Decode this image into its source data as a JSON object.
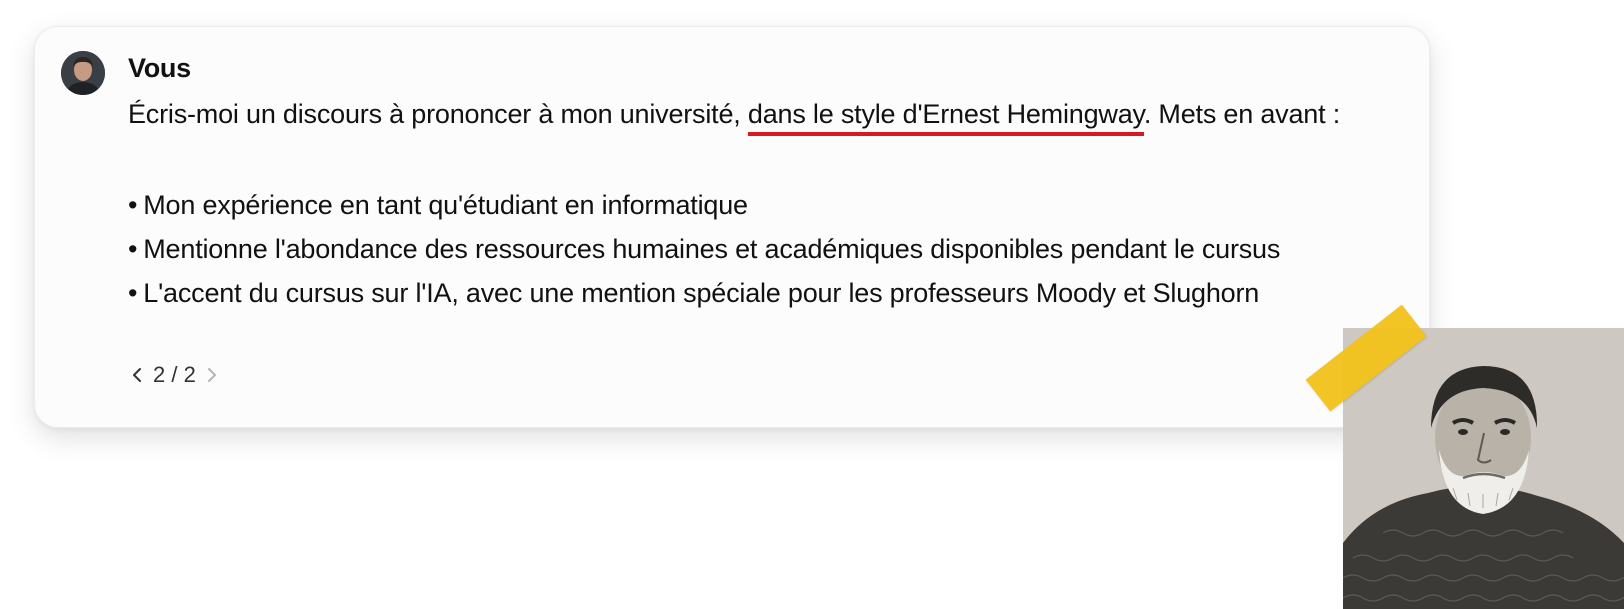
{
  "message": {
    "author": "Vous",
    "intro_before": "Écris-moi un discours à prononcer à mon université, ",
    "intro_highlight": "dans le style d'Ernest Hemingway",
    "intro_after": ". Mets en avant :",
    "bullets": [
      "Mon expérience en tant qu'étudiant en informatique",
      "Mentionne l'abondance des ressources humaines et académiques disponibles pendant le cursus",
      "L'accent du cursus sur l'IA, avec une mention spéciale pour les professeurs Moody et Slughorn"
    ]
  },
  "pager": {
    "label": "2 / 2",
    "prev_icon": "chevron-left-icon",
    "next_icon": "chevron-right-icon"
  },
  "colors": {
    "highlight_underline": "#d71920",
    "tape": "#f2c21a"
  }
}
